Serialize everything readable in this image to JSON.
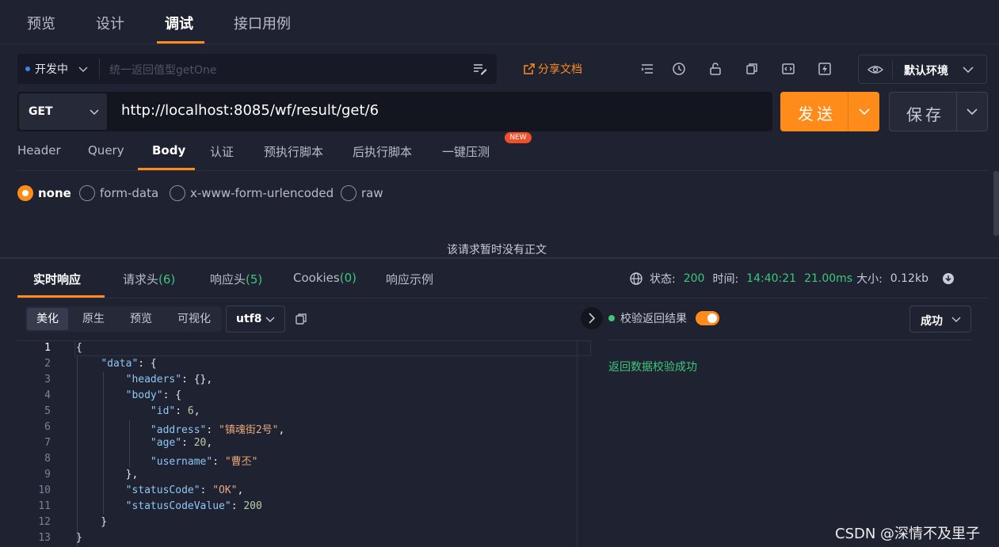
{
  "top_tabs": [
    "预览",
    "设计",
    "调试",
    "接口用例"
  ],
  "status_bar": {
    "dev_status": "开发中",
    "api_name_placeholder": "统一返回值型getOne",
    "share_doc": "分享文档",
    "environment": "默认环境"
  },
  "request": {
    "method": "GET",
    "url": "http://localhost:8085/wf/result/get/6",
    "send_label": "发送",
    "save_label": "保存"
  },
  "request_tabs": [
    "Header",
    "Query",
    "Body",
    "认证",
    "预执行脚本",
    "后执行脚本",
    "一键压测"
  ],
  "new_badge": "NEW",
  "body_types": [
    "none",
    "form-data",
    "x-www-form-urlencoded",
    "raw"
  ],
  "selected_body_type": "none",
  "no_body_text": "该请求暂时没有正文",
  "response_tabs": [
    {
      "label": "实时响应",
      "count": ""
    },
    {
      "label": "请求头",
      "count": "(6)"
    },
    {
      "label": "响应头",
      "count": "(5)"
    },
    {
      "label": "Cookies",
      "count": "(0)"
    },
    {
      "label": "响应示例",
      "count": ""
    }
  ],
  "response_status": {
    "status_label": "状态:",
    "status_value": "200",
    "time_label": "时间:",
    "time_value": "14:40:21",
    "duration": "21.00ms",
    "size_label": "大小:",
    "size_value": "0.12kb"
  },
  "format_buttons": [
    "美化",
    "原生",
    "预览",
    "可视化"
  ],
  "encoding": "utf8",
  "code_lines": [
    "{",
    "    \"data\": {",
    "        \"headers\": {},",
    "        \"body\": {",
    "            \"id\": 6,",
    "            \"address\": \"镇魂街2号\",",
    "            \"age\": 20,",
    "            \"username\": \"曹丕\"",
    "        },",
    "        \"statusCode\": \"OK\",",
    "        \"statusCodeValue\": 200",
    "    }",
    "}"
  ],
  "line_numbers": [
    "1",
    "2",
    "3",
    "4",
    "5",
    "6",
    "7",
    "8",
    "9",
    "10",
    "11",
    "12",
    "13"
  ],
  "validation": {
    "label": "校验返回结果",
    "result": "成功",
    "message": "返回数据校验成功"
  },
  "watermark": "CSDN @深情不及里子",
  "colors": {
    "accent": "#ff8c1a",
    "success": "#3ec77b",
    "background": "#1f2230"
  }
}
